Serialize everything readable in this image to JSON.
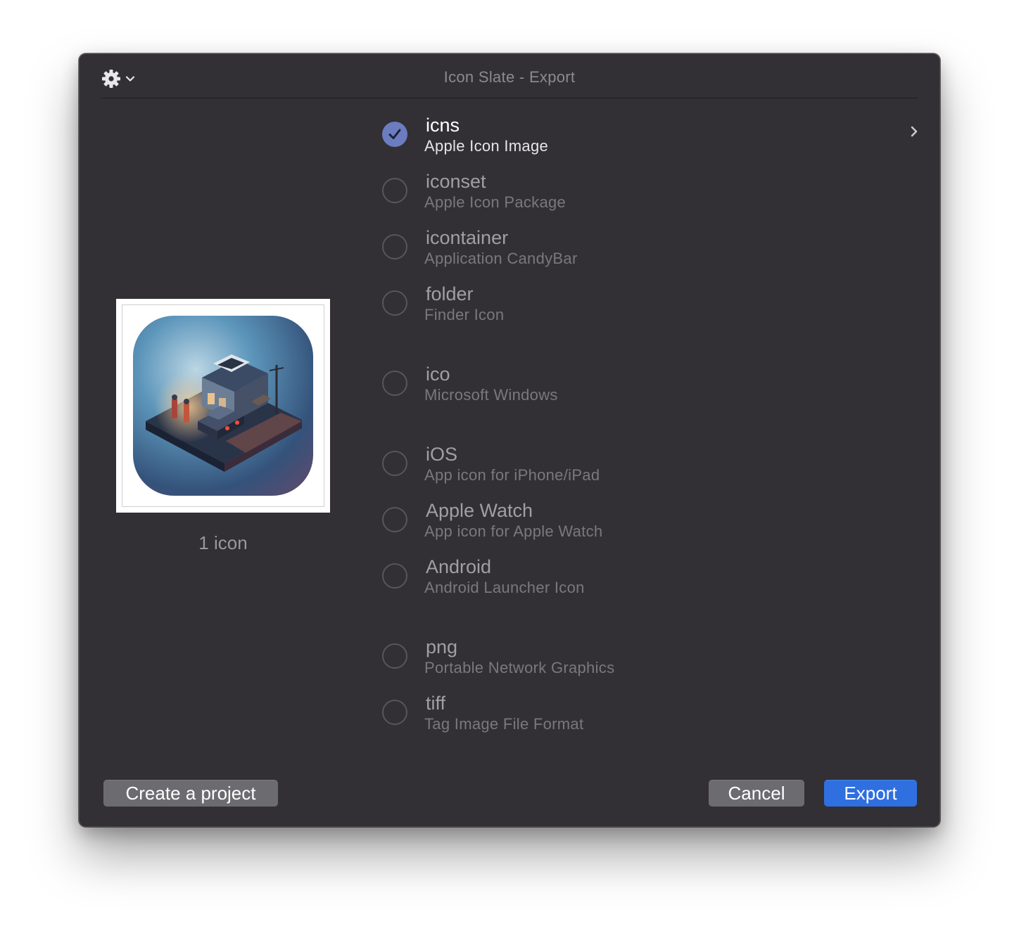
{
  "window": {
    "title": "Icon Slate - Export"
  },
  "toolbar": {
    "gear_icon": "gear-icon",
    "menu_chevron_icon": "chevron-down-icon"
  },
  "preview": {
    "count_label": "1 icon"
  },
  "formats": [
    {
      "name": "icns",
      "description": "Apple Icon Image",
      "selected": true
    },
    {
      "name": "iconset",
      "description": "Apple Icon Package",
      "selected": false
    },
    {
      "name": "icontainer",
      "description": "Application CandyBar",
      "selected": false
    },
    {
      "name": "folder",
      "description": "Finder Icon",
      "selected": false
    },
    {
      "name": "ico",
      "description": "Microsoft Windows",
      "selected": false
    },
    {
      "name": "iOS",
      "description": "App icon for iPhone/iPad",
      "selected": false
    },
    {
      "name": "Apple Watch",
      "description": "App icon for Apple Watch",
      "selected": false
    },
    {
      "name": "Android",
      "description": "Android Launcher Icon",
      "selected": false
    },
    {
      "name": "png",
      "description": "Portable Network Graphics",
      "selected": false
    },
    {
      "name": "tiff",
      "description": "Tag Image File Format",
      "selected": false
    }
  ],
  "buttons": {
    "create_project": "Create a project",
    "cancel": "Cancel",
    "export": "Export"
  },
  "colors": {
    "window_bg": "#323034",
    "accent": "#2f6fe0",
    "selected_radio": "#6b7cc0"
  }
}
